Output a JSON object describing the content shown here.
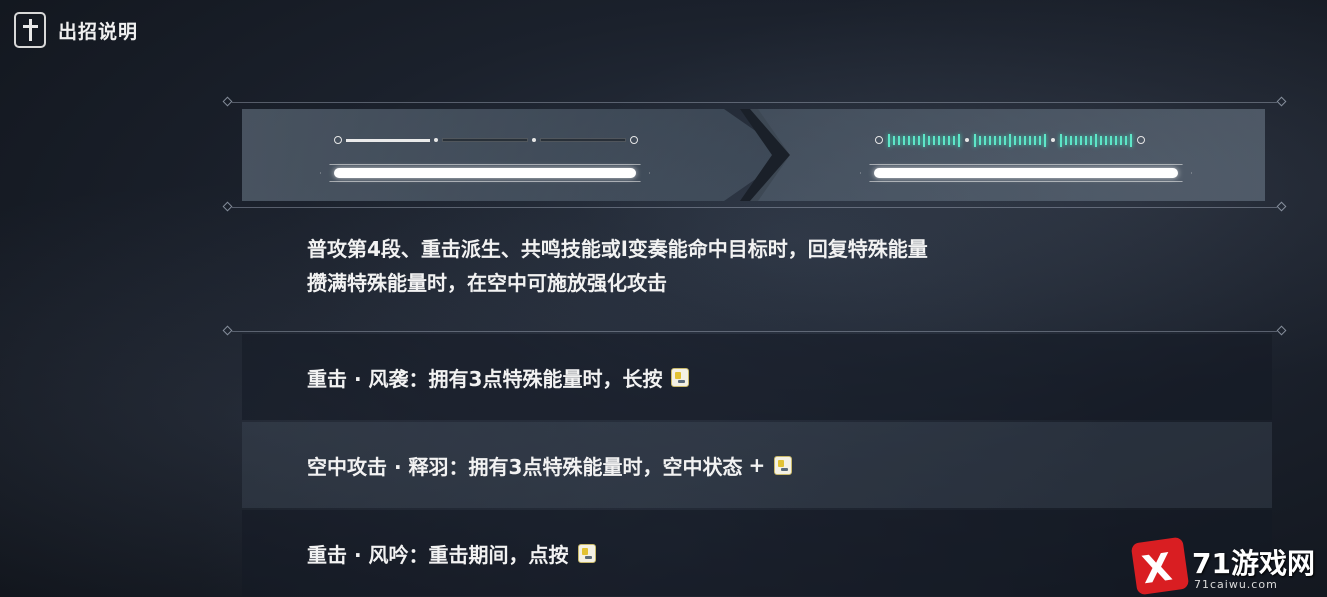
{
  "header": {
    "title": "出招说明",
    "icon": "sword-icon"
  },
  "energy_display": {
    "left_state": {
      "segments_filled": 1,
      "segments_total": 3
    },
    "right_state": {
      "style": "charged",
      "accent_color": "#5fe6c8"
    }
  },
  "description": {
    "line1": "普攻第4段、重击派生、共鸣技能或l变奏能命中目标时，回复特殊能量",
    "line2": "攒满特殊能量时，在空中可施放强化攻击"
  },
  "moves": [
    {
      "text": "重击 · 风袭：拥有3点特殊能量时，长按",
      "plus": "",
      "key_icon": "attack-key-icon"
    },
    {
      "text": "空中攻击 · 释羽：拥有3点特殊能量时，空中状态",
      "plus": "+",
      "key_icon": "attack-key-icon"
    },
    {
      "text": "重击 · 风吟：重击期间，点按",
      "plus": "",
      "key_icon": "attack-key-icon"
    }
  ],
  "watermark": {
    "brand": "71游戏网",
    "mark": "X",
    "url": "71caiwu.com"
  }
}
